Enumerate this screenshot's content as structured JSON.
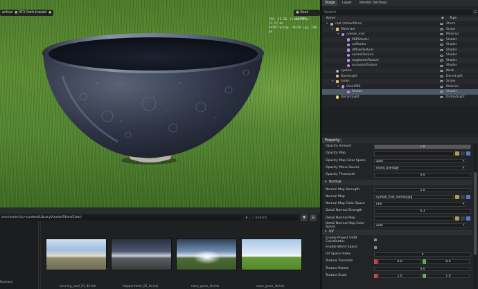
{
  "viewport": {
    "buttons": [
      "ective",
      "RTX Path-traced",
      "Root Layer"
    ],
    "stats": [
      "FPS: 42.28, Frame time: 23.57 ms",
      "PathTracing: 14/64 spp, 586 ms"
    ]
  },
  "stage": {
    "tabs": [
      "Stage",
      "Layer",
      "Render Settings"
    ],
    "search_placeholder": "Search",
    "columns": {
      "name": "Name",
      "type": "Type"
    },
    "rows": [
      {
        "name": "root (defaultPrim)",
        "type": "Xform",
        "depth": 0,
        "icon": "xform-icon"
      },
      {
        "name": "Materials",
        "type": "Scope",
        "depth": 1,
        "icon": "folder-icon"
      },
      {
        "name": "cysean_mat",
        "type": "Material",
        "depth": 2,
        "icon": "material-icon"
      },
      {
        "name": "PBRShader",
        "type": "Shader",
        "depth": 3,
        "icon": "shader-icon"
      },
      {
        "name": "uvReader",
        "type": "Shader",
        "depth": 3,
        "icon": "shader-icon"
      },
      {
        "name": "diffuseTexture",
        "type": "Shader",
        "depth": 3,
        "icon": "shader-icon"
      },
      {
        "name": "normalTexture",
        "type": "Shader",
        "depth": 3,
        "icon": "shader-icon"
      },
      {
        "name": "roughnessTexture",
        "type": "Shader",
        "depth": 3,
        "icon": "shader-icon"
      },
      {
        "name": "occlusionTexture",
        "type": "Shader",
        "depth": 3,
        "icon": "shader-icon"
      },
      {
        "name": "cysean",
        "type": "Mesh",
        "depth": 1,
        "icon": "mesh-icon"
      },
      {
        "name": "DomeLight",
        "type": "DomeLight",
        "depth": 1,
        "icon": "light-icon"
      },
      {
        "name": "Looks",
        "type": "Scope",
        "depth": 1,
        "icon": "folder-icon"
      },
      {
        "name": "OmniPBR",
        "type": "Material",
        "depth": 2,
        "icon": "material-icon"
      },
      {
        "name": "Shader",
        "type": "Shader",
        "depth": 3,
        "icon": "shader-icon",
        "selected": true
      },
      {
        "name": "DistantLight",
        "type": "DistantLight",
        "depth": 1,
        "icon": "light-icon"
      }
    ]
  },
  "property": {
    "tab": "Property",
    "rows_top": [
      {
        "label": "Opacity Amount",
        "kind": "bar",
        "value": "1.0"
      },
      {
        "label": "Opacity Map",
        "kind": "file",
        "value": ""
      },
      {
        "label": "Opacity Map Color Space",
        "kind": "dropdown",
        "value": "auto"
      },
      {
        "label": "Opacity Mono Source",
        "kind": "dropdown",
        "value": "mono_average"
      },
      {
        "label": "Opacity Threshold",
        "kind": "num",
        "value": "0.0"
      }
    ],
    "normal_section": "Normal",
    "rows_normal": [
      {
        "label": "Normal Map Strength",
        "kind": "num",
        "value": "1.0"
      },
      {
        "label": "Normal Map",
        "kind": "file",
        "value": "cysean_mat_normal.jpg"
      },
      {
        "label": "Normal Map Color Space",
        "kind": "dropdown",
        "value": "raw"
      },
      {
        "label": "Detail Normal Strength",
        "kind": "num",
        "value": "0.3"
      },
      {
        "label": "Detail Normal Map",
        "kind": "file",
        "value": ""
      },
      {
        "label": "Detail Normal Map Color Space",
        "kind": "dropdown",
        "value": "auto"
      }
    ],
    "uv_section": "UV",
    "rows_uv": [
      {
        "label": "Enable Project UVW Coordinates",
        "kind": "check"
      },
      {
        "label": "Enable World Space",
        "kind": "check"
      },
      {
        "label": "UV Space Index",
        "kind": "num",
        "value": "0"
      },
      {
        "label": "Texture Translate",
        "kind": "vec2",
        "x": "0.0",
        "y": "0.0"
      },
      {
        "label": "Texture Rotate",
        "kind": "num",
        "value": "0.0"
      },
      {
        "label": "Texture Scale",
        "kind": "vec2",
        "x": "1.0",
        "y": "1.0"
      }
    ]
  },
  "content": {
    "path": "omniverse://cv-content/Library/Assets/Skies/Clear/",
    "search_placeholder": "Search",
    "left_items": [
      "Humans",
      "ide"
    ],
    "thumbs": [
      {
        "label": "evening_road_01_4k.hdr"
      },
      {
        "label": "kloppenheim_02_4k.hdr"
      },
      {
        "label": "noon_grass_4k.hdr"
      },
      {
        "label": "noon_grass_4k.hdr"
      }
    ]
  }
}
